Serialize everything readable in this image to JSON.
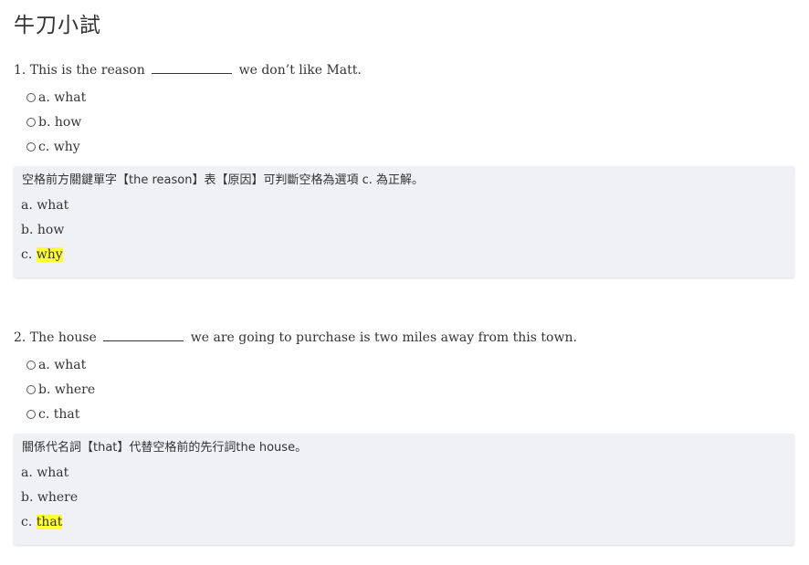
{
  "page": {
    "title": "牛刀小試"
  },
  "questions": [
    {
      "prefix": "1. This is the reason",
      "suffix": "we don’t like Matt.",
      "options": [
        "a. what",
        "b. how",
        "c. why"
      ],
      "explanation": {
        "text": "空格前方關鍵單字【the reason】表【原因】可判斷空格為選項 c. 為正解。",
        "items": [
          {
            "label": "a.",
            "answer": "what",
            "highlighted": false
          },
          {
            "label": "b.",
            "answer": "how",
            "highlighted": false
          },
          {
            "label": "c.",
            "answer": "why",
            "highlighted": true
          }
        ]
      }
    },
    {
      "prefix": "2. The house",
      "suffix": "we are going to purchase is two miles away from this town.",
      "options": [
        "a. what",
        "b. where",
        "c. that"
      ],
      "explanation": {
        "text": "關係代名詞【that】代替空格前的先行詞the house。",
        "items": [
          {
            "label": "a.",
            "answer": "what",
            "highlighted": false
          },
          {
            "label": "b.",
            "answer": "where",
            "highlighted": false
          },
          {
            "label": "c.",
            "answer": "that",
            "highlighted": true
          }
        ]
      }
    }
  ],
  "colors": {
    "highlight": "#ffff33",
    "explanation_bg": "#f0f1f5",
    "text": "#333333"
  }
}
